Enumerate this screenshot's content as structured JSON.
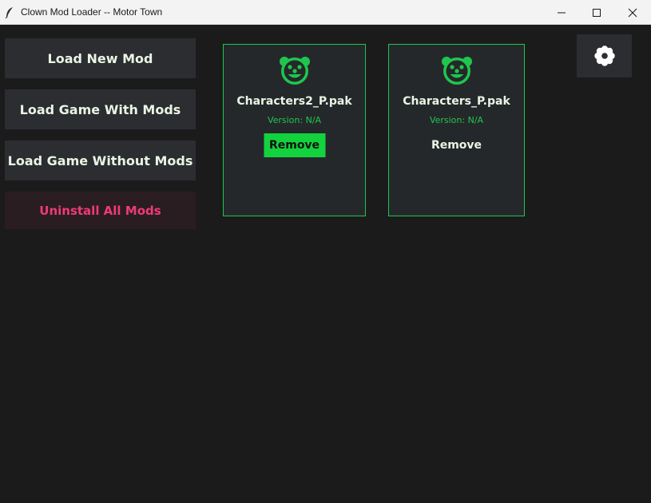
{
  "window": {
    "title": "Clown Mod Loader -- Motor Town",
    "controls": [
      "minimize-icon",
      "maximize-icon",
      "close-icon"
    ]
  },
  "actions": {
    "load_new_mod": "Load New Mod",
    "load_with_mods": "Load Game With Mods",
    "load_without_mods": "Load Game Without Mods",
    "uninstall_all": "Uninstall All Mods"
  },
  "settings": {
    "icon": "gear-icon"
  },
  "mods": [
    {
      "name": "Characters2_P.pak",
      "version": "Version: N/A",
      "remove_label": "Remove",
      "icon": "clown-face-icon"
    },
    {
      "name": "Characters_P.pak",
      "version": "Version: N/A",
      "remove_label": "Remove",
      "icon": "clown-face-icon"
    }
  ],
  "colors": {
    "background": "#1b1b1b",
    "button": "#2b2d30",
    "accent_green": "#1fc64d",
    "danger_text": "#ef3a76",
    "text": "#e9f5e4"
  }
}
